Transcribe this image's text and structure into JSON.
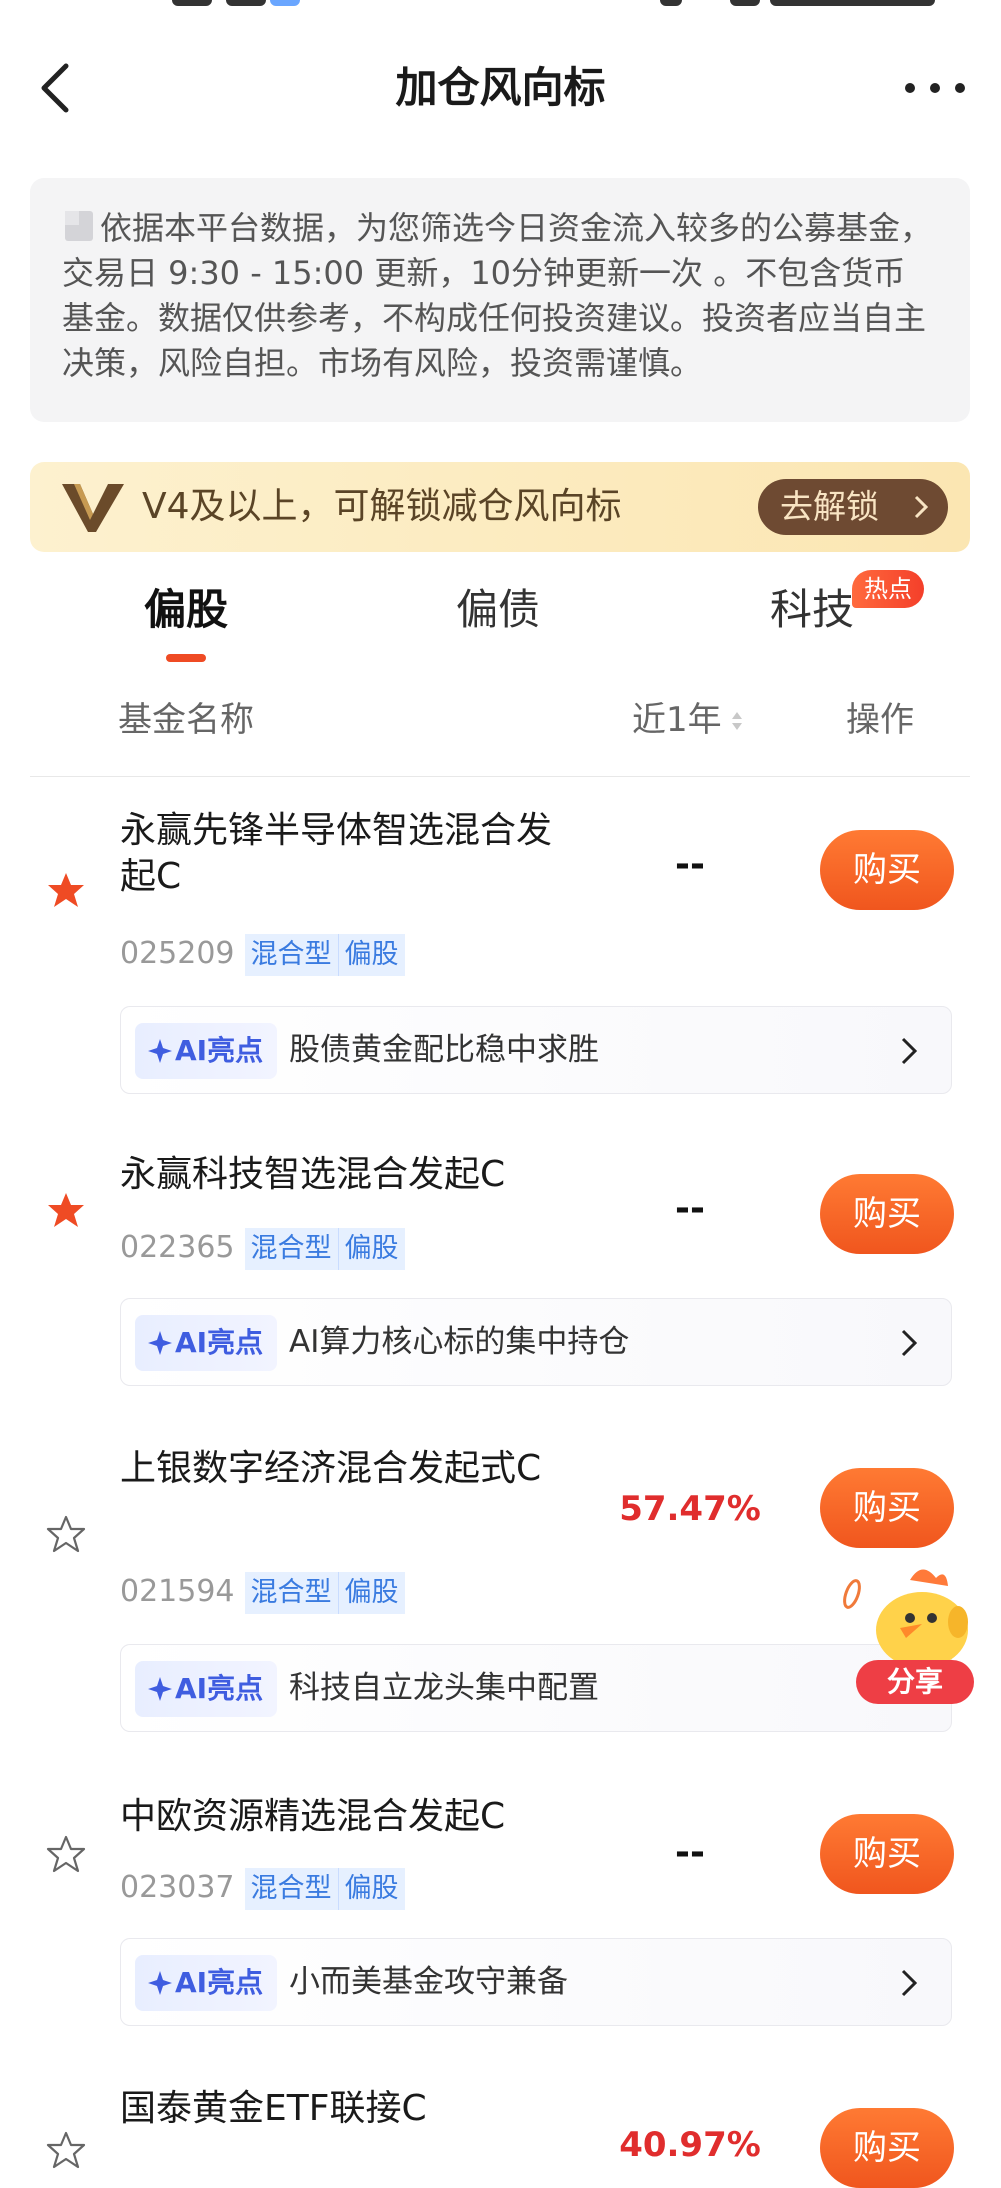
{
  "nav": {
    "title": "加仓风向标"
  },
  "notice": {
    "text": "依据本平台数据，为您筛选今日资金流入较多的公募基金，交易日 9:30 - 15:00 更新，10分钟更新一次 。不包含货币基金。数据仅供参考，不构成任何投资建议。投资者应当自主决策，风险自担。市场有风险，投资需谨慎。"
  },
  "vip": {
    "text": "V4及以上，可解锁减仓风向标",
    "button": "去解锁"
  },
  "tabs": [
    {
      "label": "偏股",
      "active": true
    },
    {
      "label": "偏债",
      "active": false
    },
    {
      "label": "科技",
      "active": false,
      "badge": "热点"
    }
  ],
  "columns": {
    "name": "基金名称",
    "period": "近1年",
    "action": "操作"
  },
  "ai_label": "AI亮点",
  "funds": [
    {
      "name": "永赢先锋半导体智选混合发起C",
      "code": "025209",
      "tags": [
        "混合型",
        "偏股"
      ],
      "return": "--",
      "starred": true,
      "buy": "购买",
      "highlight": "股债黄金配比稳中求胜"
    },
    {
      "name": "永赢科技智选混合发起C",
      "code": "022365",
      "tags": [
        "混合型",
        "偏股"
      ],
      "return": "--",
      "starred": true,
      "buy": "购买",
      "highlight": "AI算力核心标的集中持仓"
    },
    {
      "name": "上银数字经济混合发起式C",
      "code": "021594",
      "tags": [
        "混合型",
        "偏股"
      ],
      "return": "57.47%",
      "starred": false,
      "buy": "购买",
      "highlight": "科技自立龙头集中配置"
    },
    {
      "name": "中欧资源精选混合发起C",
      "code": "023037",
      "tags": [
        "混合型",
        "偏股"
      ],
      "return": "--",
      "starred": false,
      "buy": "购买",
      "highlight": "小而美基金攻守兼备"
    },
    {
      "name": "国泰黄金ETF联接C",
      "return": "40.97%",
      "starred": false,
      "buy": "购买"
    }
  ],
  "mascot": {
    "share": "分享"
  },
  "colors": {
    "accent": "#f0561e",
    "red": "#e02d2d",
    "ai_blue": "#3f5de0",
    "star_on": "#ef4b24"
  }
}
